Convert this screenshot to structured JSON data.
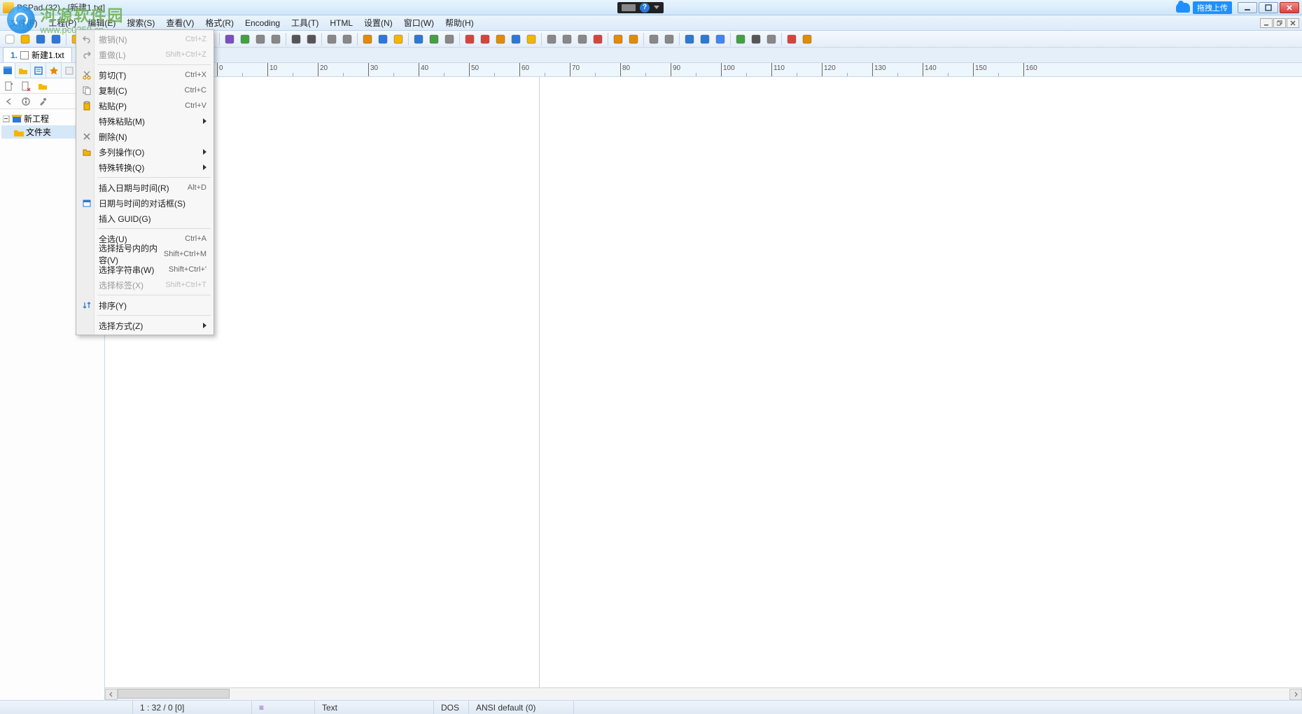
{
  "title": "PSPad (32) - [新建1.txt]",
  "cloud_upload": "拖拽上传",
  "watermark": {
    "cn": "河源软件园",
    "url": "www.pc0359.cn"
  },
  "menu": {
    "items": [
      {
        "label": "文件(F)"
      },
      {
        "label": "工程(P)"
      },
      {
        "label": "编辑(E)"
      },
      {
        "label": "搜索(S)"
      },
      {
        "label": "查看(V)"
      },
      {
        "label": "格式(R)"
      },
      {
        "label": "Encoding"
      },
      {
        "label": "工具(T)"
      },
      {
        "label": "HTML"
      },
      {
        "label": "设置(N)"
      },
      {
        "label": "窗口(W)"
      },
      {
        "label": "帮助(H)"
      }
    ]
  },
  "tab": {
    "num": "1.",
    "name": "新建1.txt"
  },
  "tree": {
    "root": "新工程",
    "child": "文件夹"
  },
  "context_menu": {
    "items": [
      {
        "label": "撤销(N)",
        "shortcut": "Ctrl+Z",
        "disabled": true,
        "icon": "undo"
      },
      {
        "label": "重做(L)",
        "shortcut": "Shift+Ctrl+Z",
        "disabled": true,
        "icon": "redo"
      },
      {
        "sep": true
      },
      {
        "label": "剪切(T)",
        "shortcut": "Ctrl+X",
        "icon": "cut"
      },
      {
        "label": "复制(C)",
        "shortcut": "Ctrl+C",
        "icon": "copy"
      },
      {
        "label": "粘贴(P)",
        "shortcut": "Ctrl+V",
        "icon": "paste"
      },
      {
        "label": "特殊粘贴(M)",
        "submenu": true
      },
      {
        "label": "删除(N)",
        "icon": "delete"
      },
      {
        "label": "多列操作(O)",
        "submenu": true,
        "icon": "columns"
      },
      {
        "label": "特殊转换(Q)",
        "submenu": true
      },
      {
        "sep": true
      },
      {
        "label": "插入日期与时间(R)",
        "shortcut": "Alt+D"
      },
      {
        "label": "日期与时间的对话框(S)",
        "icon": "datetime"
      },
      {
        "label": "插入 GUID(G)"
      },
      {
        "sep": true
      },
      {
        "label": "全选(U)",
        "shortcut": "Ctrl+A"
      },
      {
        "label": "选择括号内的内容(V)",
        "shortcut": "Shift+Ctrl+M"
      },
      {
        "label": "选择字符串(W)",
        "shortcut": "Shift+Ctrl+'"
      },
      {
        "label": "选择标签(X)",
        "shortcut": "Shift+Ctrl+T",
        "disabled": true
      },
      {
        "sep": true
      },
      {
        "label": "排序(Y)",
        "icon": "sort"
      },
      {
        "sep": true
      },
      {
        "label": "选择方式(Z)",
        "submenu": true
      }
    ]
  },
  "ruler": {
    "start": 0,
    "end": 160,
    "step": 10,
    "minor": 5
  },
  "status": {
    "pos": "1 : 32 / 0   [0]",
    "mode_icon": "=",
    "syntax": "Text",
    "eol": "DOS",
    "encoding": "ANSI default (0)"
  }
}
